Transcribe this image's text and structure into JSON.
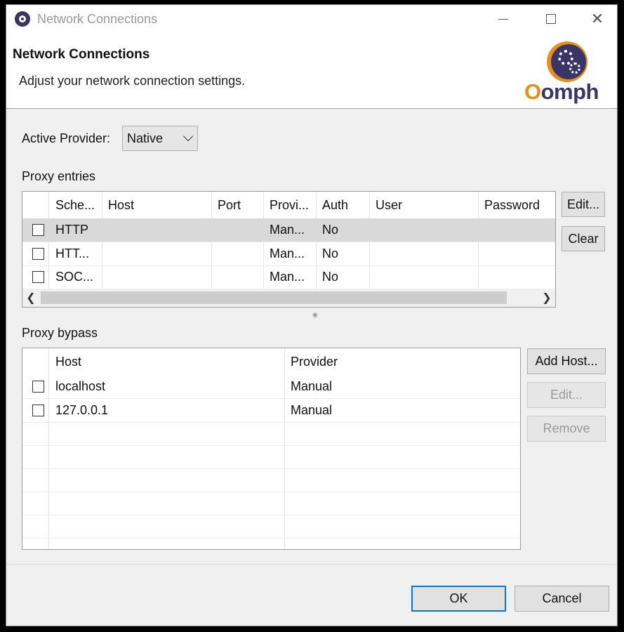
{
  "window": {
    "title": "Network Connections",
    "controls": {
      "minimize": "minimize",
      "maximize": "maximize",
      "close": "✕"
    }
  },
  "banner": {
    "title": "Network Connections",
    "subtitle": "Adjust your network connection settings.",
    "logo_text_o": "O",
    "logo_text_rest": "omph"
  },
  "provider": {
    "label": "Active Provider:",
    "value": "Native"
  },
  "proxy_entries": {
    "label": "Proxy entries",
    "columns": [
      "Sche...",
      "Host",
      "Port",
      "Provi...",
      "Auth",
      "User",
      "Password"
    ],
    "rows": [
      {
        "checked": false,
        "scheme": "HTTP",
        "host": "",
        "port": "",
        "provider": "Man...",
        "auth": "No",
        "user": "",
        "password": ""
      },
      {
        "checked": false,
        "scheme": "HTT...",
        "host": "",
        "port": "",
        "provider": "Man...",
        "auth": "No",
        "user": "",
        "password": ""
      },
      {
        "checked": false,
        "scheme": "SOC...",
        "host": "",
        "port": "",
        "provider": "Man...",
        "auth": "No",
        "user": "",
        "password": ""
      }
    ],
    "buttons": {
      "edit": "Edit...",
      "clear": "Clear"
    }
  },
  "proxy_bypass": {
    "label": "Proxy bypass",
    "columns": [
      "Host",
      "Provider"
    ],
    "rows": [
      {
        "checked": false,
        "host": "localhost",
        "provider": "Manual"
      },
      {
        "checked": false,
        "host": "127.0.0.1",
        "provider": "Manual"
      }
    ],
    "buttons": {
      "add_host": "Add Host...",
      "edit": "Edit...",
      "remove": "Remove"
    }
  },
  "footer": {
    "ok": "OK",
    "cancel": "Cancel"
  },
  "colors": {
    "accent": "#0078d7",
    "logo_orange": "#e8901e",
    "logo_purple": "#3b3566"
  }
}
